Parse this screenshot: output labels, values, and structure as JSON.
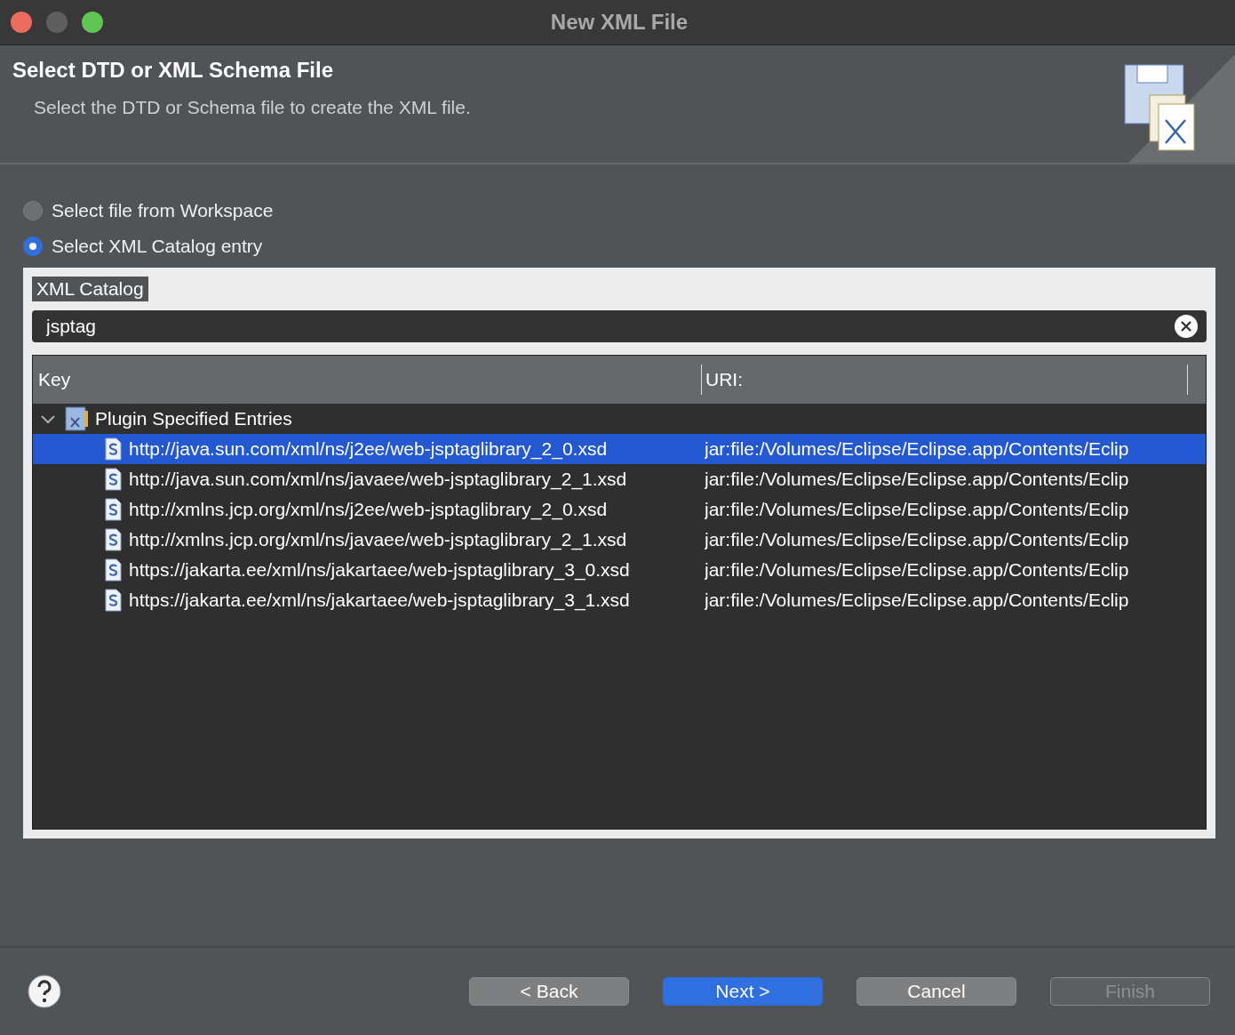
{
  "window": {
    "title": "New XML File"
  },
  "header": {
    "title": "Select DTD or XML Schema File",
    "description": "Select the DTD or Schema file to create the XML file."
  },
  "source_options": [
    {
      "label": "Select file from Workspace",
      "selected": false
    },
    {
      "label": "Select XML Catalog entry",
      "selected": true
    }
  ],
  "catalog": {
    "group_label": "XML Catalog",
    "search": {
      "value": "jsptag"
    },
    "columns": [
      "Key",
      "URI:"
    ],
    "tree": [
      {
        "label": "Plugin Specified Entries",
        "expanded": true,
        "children": [
          {
            "key": "http://java.sun.com/xml/ns/j2ee/web-jsptaglibrary_2_0.xsd",
            "uri": "jar:file:/Volumes/Eclipse/Eclipse.app/Contents/Eclip",
            "selected": true
          },
          {
            "key": "http://java.sun.com/xml/ns/javaee/web-jsptaglibrary_2_1.xsd",
            "uri": "jar:file:/Volumes/Eclipse/Eclipse.app/Contents/Eclip",
            "selected": false
          },
          {
            "key": "http://xmlns.jcp.org/xml/ns/j2ee/web-jsptaglibrary_2_0.xsd",
            "uri": "jar:file:/Volumes/Eclipse/Eclipse.app/Contents/Eclip",
            "selected": false
          },
          {
            "key": "http://xmlns.jcp.org/xml/ns/javaee/web-jsptaglibrary_2_1.xsd",
            "uri": "jar:file:/Volumes/Eclipse/Eclipse.app/Contents/Eclip",
            "selected": false
          },
          {
            "key": "https://jakarta.ee/xml/ns/jakartaee/web-jsptaglibrary_3_0.xsd",
            "uri": "jar:file:/Volumes/Eclipse/Eclipse.app/Contents/Eclip",
            "selected": false
          },
          {
            "key": "https://jakarta.ee/xml/ns/jakartaee/web-jsptaglibrary_3_1.xsd",
            "uri": "jar:file:/Volumes/Eclipse/Eclipse.app/Contents/Eclip",
            "selected": false
          }
        ]
      }
    ]
  },
  "buttons": [
    {
      "label": "< Back",
      "kind": "normal",
      "disabled": false
    },
    {
      "label": "Next >",
      "kind": "primary",
      "disabled": false
    },
    {
      "label": "Cancel",
      "kind": "normal",
      "disabled": false
    },
    {
      "label": "Finish",
      "kind": "normal",
      "disabled": true
    }
  ]
}
